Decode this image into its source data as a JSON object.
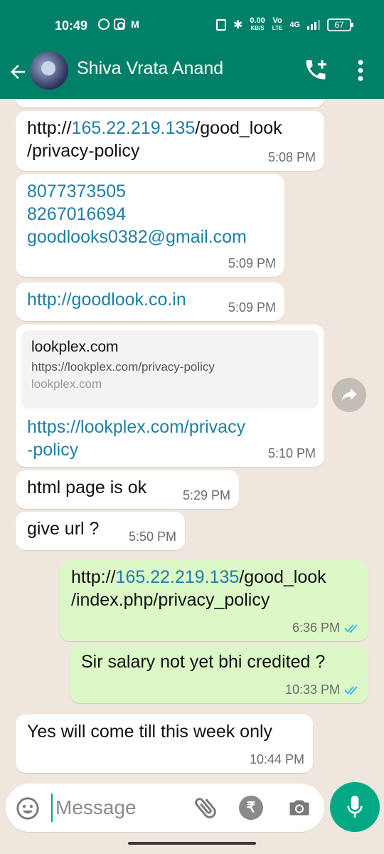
{
  "status_bar": {
    "time": "10:49",
    "speed_value": "0.00",
    "speed_unit": "KB/S",
    "volte_top": "Vo",
    "volte_bottom": "LTE",
    "network": "4G",
    "battery": "67"
  },
  "header": {
    "contact_name": "Shiva Vrata Anand",
    "back_icon": "arrow-left-icon",
    "call_icon": "add-call-icon",
    "menu_icon": "more-vertical-icon"
  },
  "messages": [
    {
      "direction": "in",
      "text_parts": [
        "http://",
        "165.22.219.135",
        "/good_look",
        "/privacy-policy"
      ],
      "time": "5:08 PM"
    },
    {
      "direction": "in",
      "lines": [
        "8077373505",
        "8267016694",
        "goodlooks0382@gmail.com"
      ],
      "time": "5:09 PM"
    },
    {
      "direction": "in",
      "text": "http://goodlook.co.in",
      "time": "5:09 PM"
    },
    {
      "direction": "in",
      "preview": {
        "title": "lookplex.com",
        "url": "https://lookplex.com/privacy-policy",
        "domain": "lookplex.com"
      },
      "lines": [
        "https://lookplex.com/privacy",
        "-policy"
      ],
      "time": "5:10 PM"
    },
    {
      "direction": "in",
      "text": "html page is ok",
      "time": "5:29 PM"
    },
    {
      "direction": "in",
      "text": "give url ?",
      "time": "5:50 PM"
    },
    {
      "direction": "out",
      "text_parts": [
        "http://",
        "165.22.219.135",
        "/good_look",
        "/index.php/privacy_policy"
      ],
      "time": "6:36 PM",
      "status": "read"
    },
    {
      "direction": "out",
      "text": "Sir salary not yet bhi credited ?",
      "time": "10:33 PM",
      "status": "read"
    },
    {
      "direction": "in",
      "text": "Yes will come till this week only",
      "time": "10:44 PM"
    }
  ],
  "input_bar": {
    "placeholder": "Message",
    "rupee_symbol": "₹"
  },
  "colors": {
    "brand": "#008069",
    "link": "#1f7fa6",
    "outgoing_bubble": "#dcf8c6",
    "read_tick": "#34b7f1",
    "fab": "#00a884"
  }
}
